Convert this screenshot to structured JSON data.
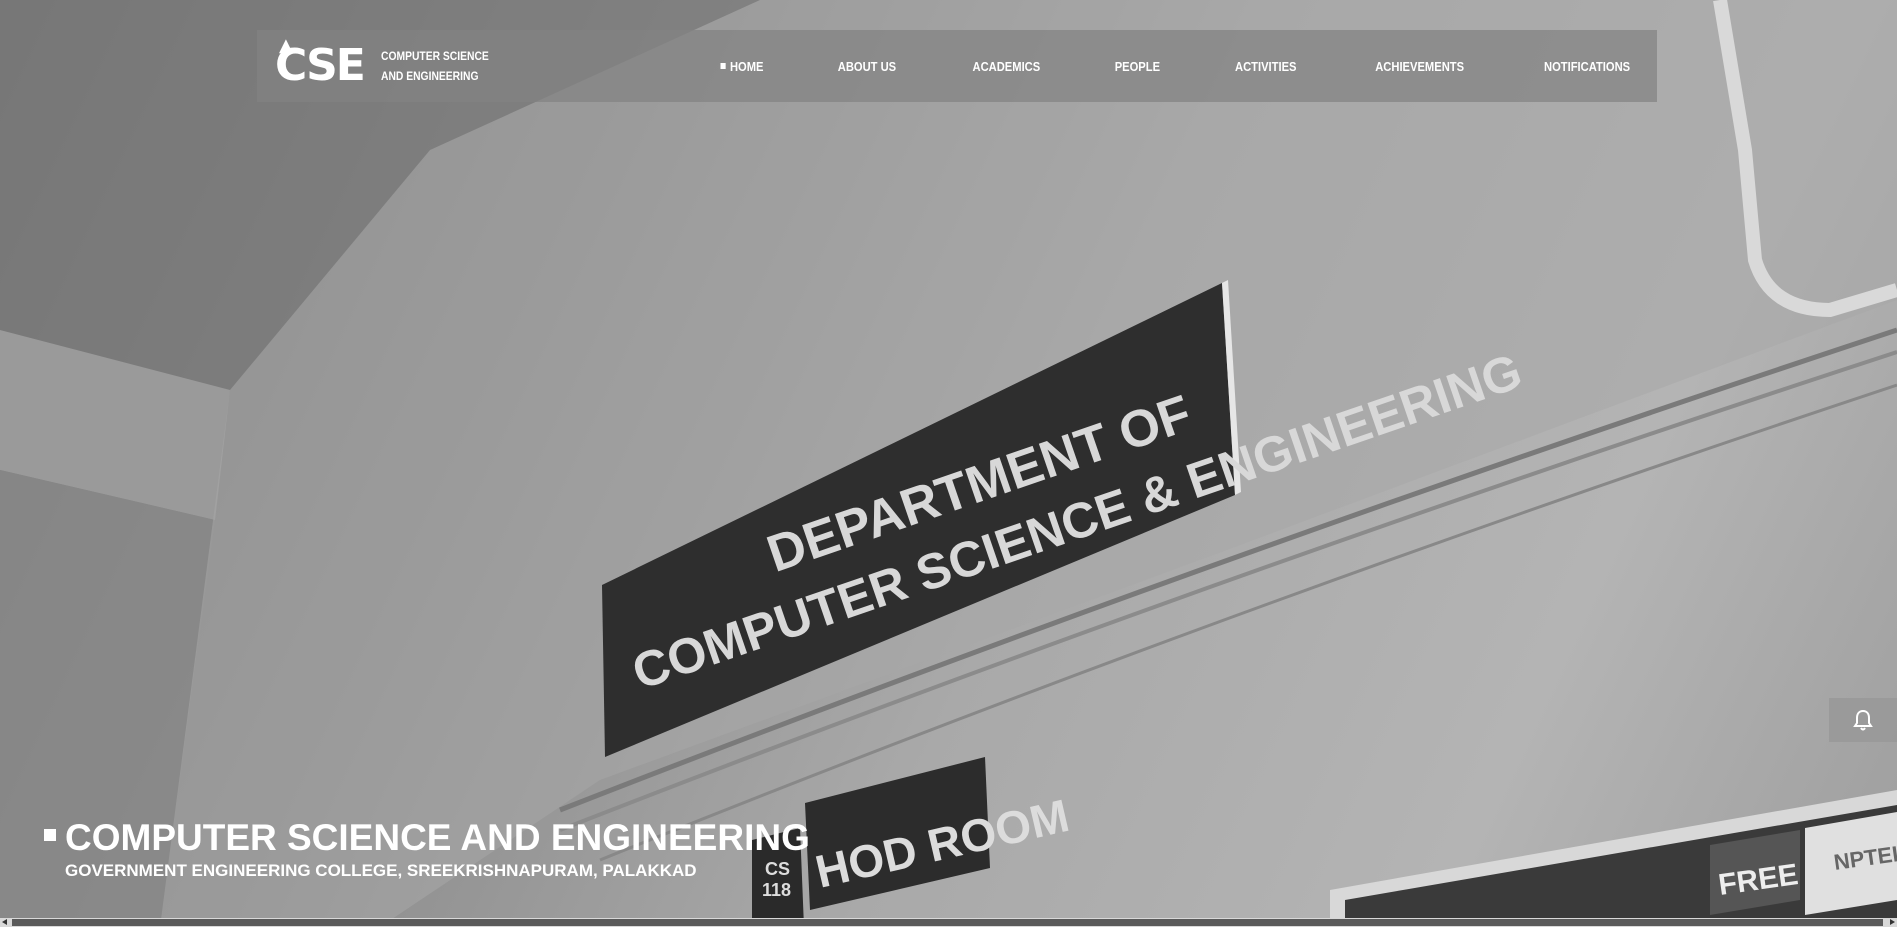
{
  "brand": {
    "logo_text": "CSE",
    "line1": "COMPUTER SCIENCE",
    "line2": "AND ENGINEERING"
  },
  "nav": {
    "items": [
      {
        "label": "HOME",
        "active": true
      },
      {
        "label": "ABOUT US"
      },
      {
        "label": "ACADEMICS"
      },
      {
        "label": "PEOPLE"
      },
      {
        "label": "ACTIVITIES"
      },
      {
        "label": "ACHIEVEMENTS"
      },
      {
        "label": "NOTIFICATIONS"
      }
    ]
  },
  "hero": {
    "title": "COMPUTER SCIENCE AND ENGINEERING",
    "subtitle": "GOVERNMENT ENGINEERING COLLEGE, SREEKRISHNAPURAM, PALAKKAD",
    "sign_line1": "DEPARTMENT OF",
    "sign_line2": "COMPUTER SCIENCE & ENGINEERING",
    "hod_sign": "HOD ROOM",
    "room_number_line1": "CS",
    "room_number_line2": "118",
    "poster_text": "FREE",
    "poster_brand": "NPTEL"
  },
  "notification_button": {
    "icon": "bell-icon"
  }
}
